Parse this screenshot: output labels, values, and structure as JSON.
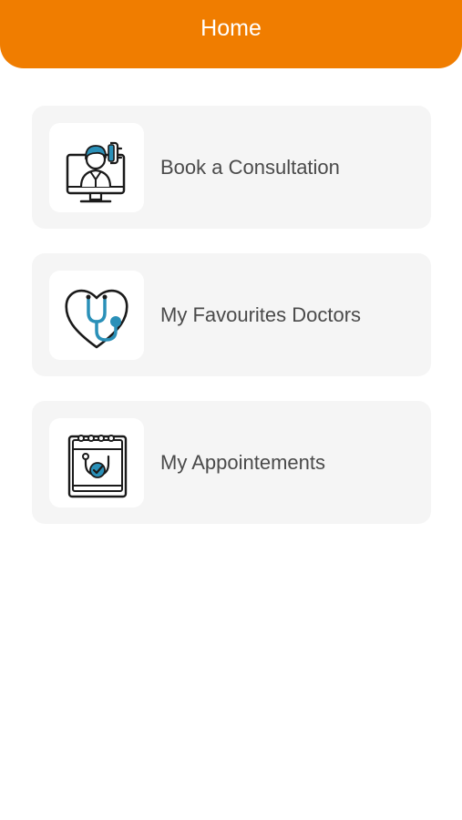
{
  "header": {
    "title": "Home"
  },
  "colors": {
    "header_bg": "#F07D00",
    "accent": "#2A90B8",
    "card_bg": "#F5F5F5",
    "label": "#4A4A4A"
  },
  "menu": {
    "items": [
      {
        "label": "Book a Consultation",
        "icon": "online-doctor-icon"
      },
      {
        "label": "My Favourites Doctors",
        "icon": "heart-stethoscope-icon"
      },
      {
        "label": "My Appointements",
        "icon": "calendar-checkup-icon"
      }
    ]
  }
}
